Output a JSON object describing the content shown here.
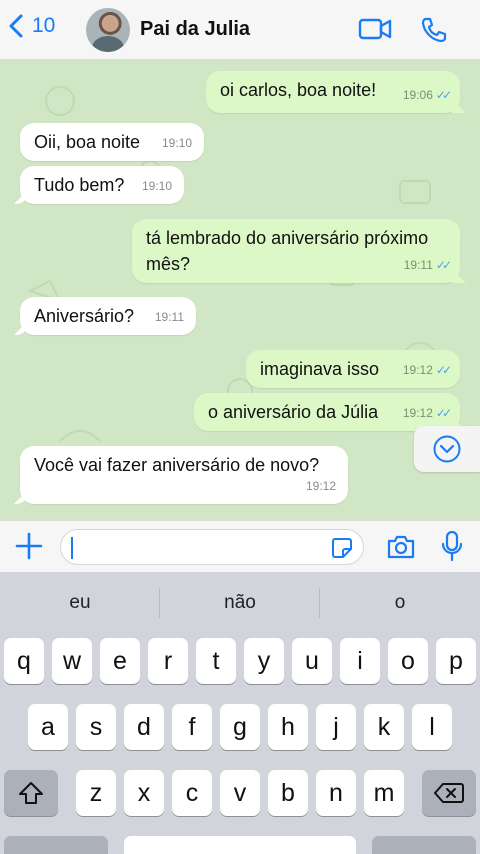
{
  "header": {
    "back_count": "10",
    "contact_name": "Pai da Julia",
    "icons": [
      "chevron-left-icon",
      "video-icon",
      "phone-icon"
    ]
  },
  "messages": [
    {
      "dir": "out",
      "text": "oi carlos, boa noite!",
      "time": "19:06"
    },
    {
      "dir": "in",
      "text": "Oii, boa noite",
      "time": "19:10"
    },
    {
      "dir": "in",
      "text": "Tudo bem?",
      "time": "19:10"
    },
    {
      "dir": "out",
      "text_line1": "tá lembrado do aniversário próximo",
      "text_line2": "mês?",
      "time": "19:11"
    },
    {
      "dir": "in",
      "text": "Aniversário?",
      "time": "19:11"
    },
    {
      "dir": "out",
      "text": "imaginava isso",
      "time": "19:12"
    },
    {
      "dir": "out",
      "text": "o aniversário da Júlia",
      "time": "19:12"
    },
    {
      "dir": "in",
      "text": "Você vai fazer aniversário de novo?",
      "time": "19:12"
    }
  ],
  "colors": {
    "accent": "#1a7cf5",
    "chat_bg": "#d1e6c5",
    "outgoing_bubble": "#dcf8c6",
    "incoming_bubble": "#ffffff",
    "read_ticks": "#4fa3e0"
  },
  "keyboard": {
    "suggestions": [
      "eu",
      "não",
      "o"
    ],
    "row1": [
      "q",
      "w",
      "e",
      "r",
      "t",
      "y",
      "u",
      "i",
      "o",
      "p"
    ],
    "row2": [
      "a",
      "s",
      "d",
      "f",
      "g",
      "h",
      "j",
      "k",
      "l"
    ],
    "row3": [
      "z",
      "x",
      "c",
      "v",
      "b",
      "n",
      "m"
    ]
  }
}
